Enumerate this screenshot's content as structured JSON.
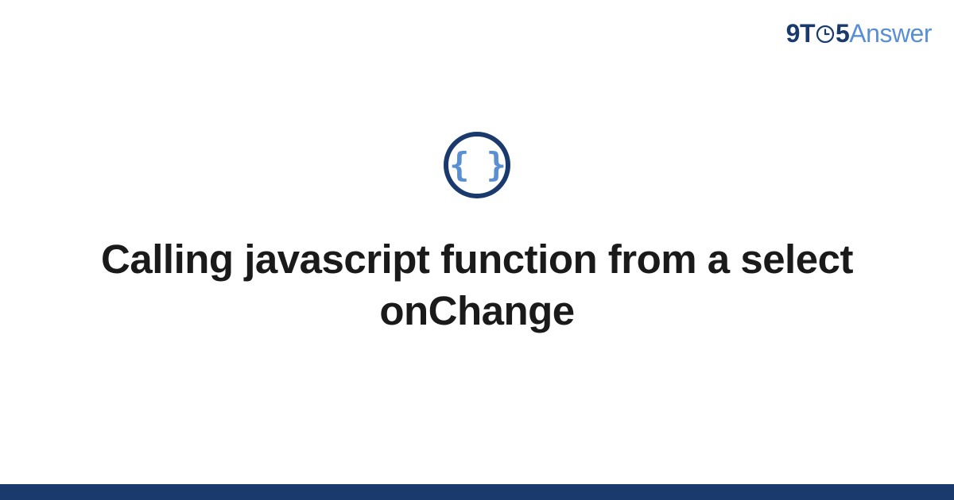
{
  "brand": {
    "part1": "9T",
    "part2": "5",
    "part3": "Answer"
  },
  "badge": {
    "symbol": "{ }"
  },
  "title": "Calling javascript function from a select onChange",
  "colors": {
    "primary": "#1a3a6e",
    "accent": "#5a8fd4"
  }
}
